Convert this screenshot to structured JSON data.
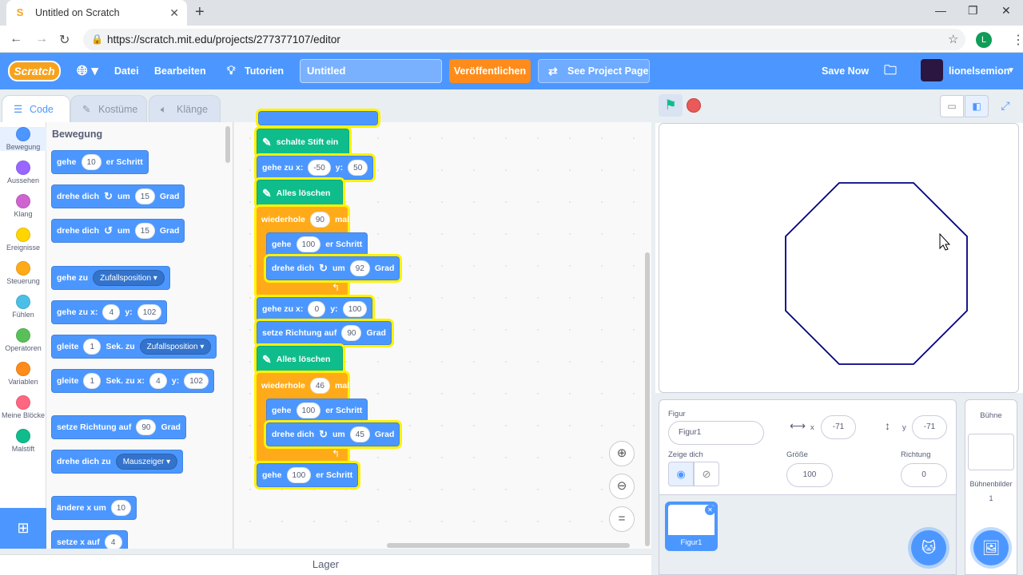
{
  "browser": {
    "tab_title": "Untitled on Scratch",
    "url": "https://scratch.mit.edu/projects/277377107/editor",
    "profile_initial": "L"
  },
  "menu": {
    "logo": "Scratch",
    "file": "Datei",
    "edit": "Bearbeiten",
    "tutorials": "Tutorien",
    "project_title": "Untitled",
    "publish": "Veröffentlichen",
    "see_project": "See Project Page",
    "save_now": "Save Now",
    "username": "lionelsemion"
  },
  "editor_tabs": [
    "Code",
    "Kostüme",
    "Klänge"
  ],
  "categories": [
    {
      "label": "Bewegung",
      "color": "#4c97ff"
    },
    {
      "label": "Aussehen",
      "color": "#9966ff"
    },
    {
      "label": "Klang",
      "color": "#cf63cf"
    },
    {
      "label": "Ereignisse",
      "color": "#ffd500"
    },
    {
      "label": "Steuerung",
      "color": "#ffab19"
    },
    {
      "label": "Fühlen",
      "color": "#4cbfe6"
    },
    {
      "label": "Operatoren",
      "color": "#59c059"
    },
    {
      "label": "Variablen",
      "color": "#ff8c1a"
    },
    {
      "label": "Meine Blöcke",
      "color": "#ff6680"
    },
    {
      "label": "Malstift",
      "color": "#0fbd8c"
    }
  ],
  "palette": {
    "heading": "Bewegung",
    "b1": {
      "a": "gehe",
      "v": "10",
      "b": "er Schritt"
    },
    "b2": {
      "a": "drehe dich",
      "b": "um",
      "v": "15",
      "c": "Grad"
    },
    "b3": {
      "a": "drehe dich",
      "b": "um",
      "v": "15",
      "c": "Grad"
    },
    "b4": {
      "a": "gehe zu",
      "d": "Zufallsposition"
    },
    "b5": {
      "a": "gehe zu x:",
      "x": "4",
      "b": "y:",
      "y": "102"
    },
    "b6": {
      "a": "gleite",
      "v": "1",
      "b": "Sek. zu",
      "d": "Zufallsposition"
    },
    "b7": {
      "a": "gleite",
      "v": "1",
      "b": "Sek. zu x:",
      "x": "4",
      "c": "y:",
      "y": "102"
    },
    "b8": {
      "a": "setze Richtung auf",
      "v": "90",
      "b": "Grad"
    },
    "b9": {
      "a": "drehe dich zu",
      "d": "Mauszeiger"
    },
    "b10": {
      "a": "ändere x um",
      "v": "10"
    },
    "b11": {
      "a": "setze x auf",
      "v": "4"
    }
  },
  "script": {
    "s1": "schalte Stift ein",
    "s2": {
      "a": "gehe zu x:",
      "x": "-50",
      "b": "y:",
      "y": "50"
    },
    "s3": "Alles löschen",
    "s4": {
      "a": "wiederhole",
      "v": "90",
      "b": "mal"
    },
    "s5": {
      "a": "gehe",
      "v": "100",
      "b": "er Schritt"
    },
    "s6": {
      "a": "drehe dich",
      "b": "um",
      "v": "92",
      "c": "Grad"
    },
    "s7": {
      "a": "gehe zu x:",
      "x": "0",
      "b": "y:",
      "y": "100"
    },
    "s8": {
      "a": "setze Richtung auf",
      "v": "90",
      "b": "Grad"
    },
    "s9": "Alles löschen",
    "s10": {
      "a": "wiederhole",
      "v": "46",
      "b": "mal"
    },
    "s11": {
      "a": "gehe",
      "v": "100",
      "b": "er Schritt"
    },
    "s12": {
      "a": "drehe dich",
      "b": "um",
      "v": "45",
      "c": "Grad"
    },
    "s13": {
      "a": "gehe",
      "v": "100",
      "b": "er Schritt"
    }
  },
  "lager": "Lager",
  "sprite": {
    "label": "Figur",
    "name": "Figur1",
    "x_label": "x",
    "x": "-71",
    "y_label": "y",
    "y": "-71",
    "show_label": "Zeige dich",
    "size_label": "Größe",
    "size": "100",
    "direction_label": "Richtung",
    "direction": "0",
    "thumb_name": "Figur1"
  },
  "backdrop": {
    "label": "Bühne",
    "count_label": "Bühnenbilder",
    "count": "1"
  },
  "colors": {
    "scratch_blue": "#4c97ff",
    "motion": "#4c97ff",
    "pen": "#0fbd8c",
    "control": "#ffab19",
    "highlight": "#fff200",
    "pen_line": "#000080"
  }
}
